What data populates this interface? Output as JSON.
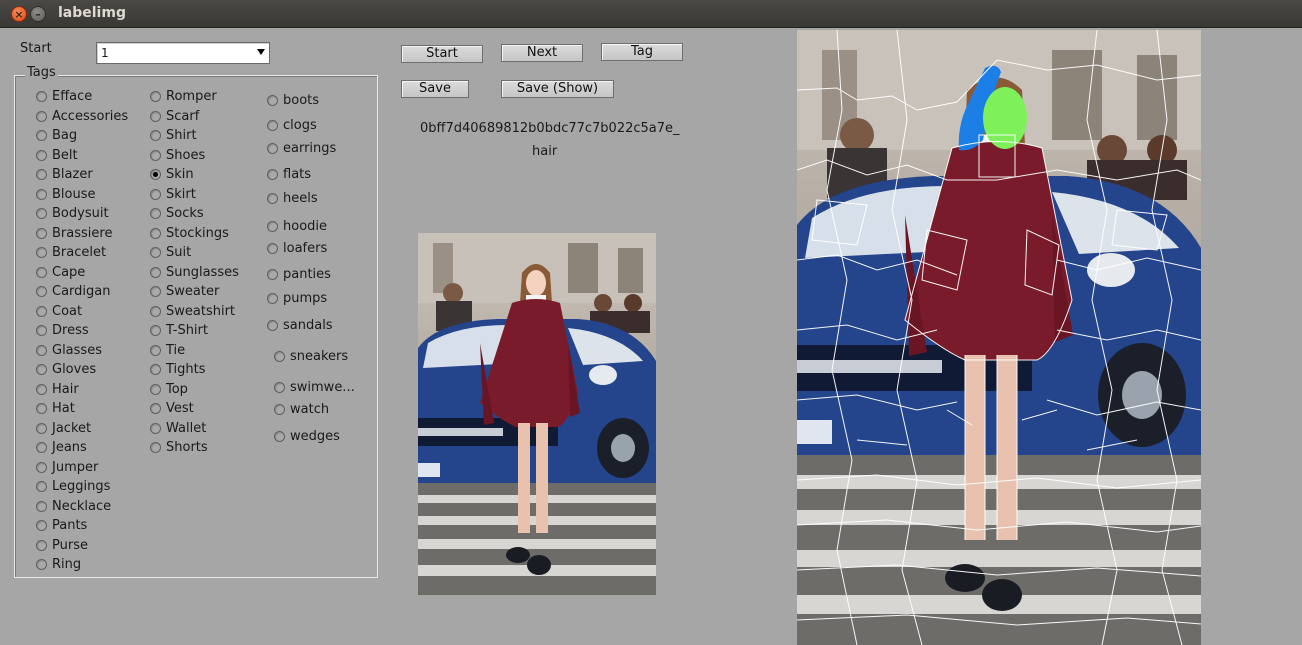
{
  "window": {
    "title": "labelimg",
    "close_glyph": "×",
    "min_glyph": "–"
  },
  "start": {
    "label": "Start",
    "selected": "1"
  },
  "tags": {
    "legend": "Tags",
    "selected": "Skin",
    "col1": [
      "Efface",
      "Accessories",
      "Bag",
      "Belt",
      "Blazer",
      "Blouse",
      "Bodysuit",
      "Brassiere",
      "Bracelet",
      "Cape",
      "Cardigan",
      "Coat",
      "Dress",
      "Glasses",
      "Gloves",
      "Hair",
      "Hat",
      "Jacket",
      "Jeans",
      "Jumper",
      "Leggings",
      "Necklace",
      "Pants",
      "Purse",
      "Ring"
    ],
    "col2": [
      "Romper",
      "Scarf",
      "Shirt",
      "Shoes",
      "Skin",
      "Skirt",
      "Socks",
      "Stockings",
      "Suit",
      "Sunglasses",
      "Sweater",
      "Sweatshirt",
      "T-Shirt",
      "Tie",
      "Tights",
      "Top",
      "Vest",
      "Wallet",
      "Shorts"
    ],
    "col3": [
      "boots",
      "clogs",
      "earrings",
      "flats",
      "heels",
      "hoodie",
      "loafers",
      "panties",
      "pumps",
      "sandals",
      "sneakers",
      "swimwe...",
      "watch",
      "wedges"
    ]
  },
  "buttons": {
    "start": "Start",
    "next": "Next",
    "tag": "Tag",
    "save": "Save",
    "save_show": "Save (Show)"
  },
  "info": {
    "image_id": "0bff7d40689812b0bdc77c7b022c5a7e_",
    "current_tag": "hair"
  },
  "images": {
    "preview": "street-photo-woman-red-coat",
    "segmentation": "superpixel-segmentation-overlay"
  },
  "colors": {
    "window_bg": "#a6a6a6",
    "hair_mask": "#1c7fe6",
    "skin_mask": "#7df05a",
    "coat": "#7a1b2c"
  }
}
